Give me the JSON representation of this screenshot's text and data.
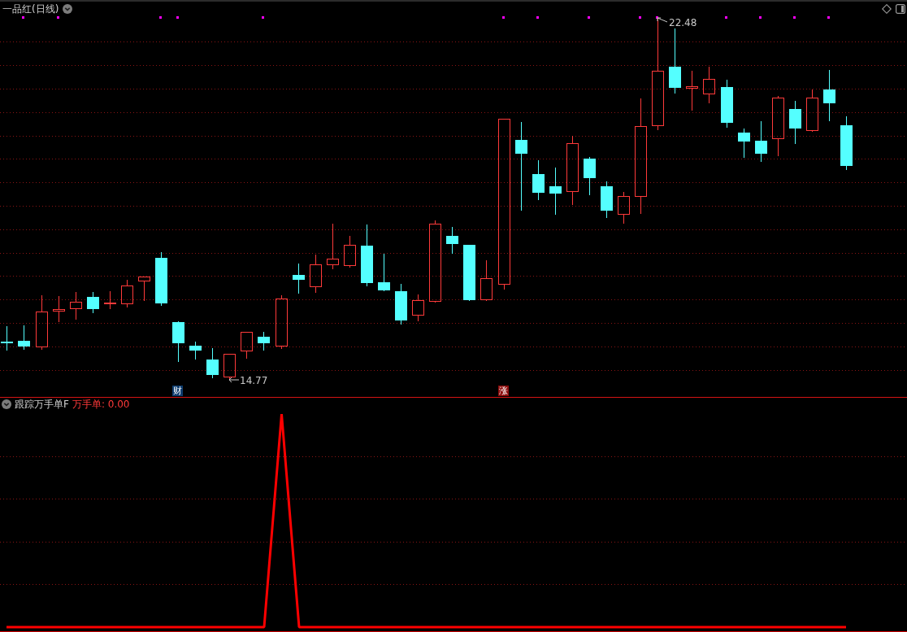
{
  "price_panel": {
    "title": "一品红(日线)",
    "high_label": "22.48",
    "low_label": "14.77",
    "tags": [
      {
        "text": "财",
        "color": "#0e3c6e"
      },
      {
        "text": "涨",
        "color": "#8c0c0c"
      }
    ]
  },
  "indicator_panel": {
    "title": "跟踪万手单F",
    "reading": "万手单: 0.00"
  }
}
